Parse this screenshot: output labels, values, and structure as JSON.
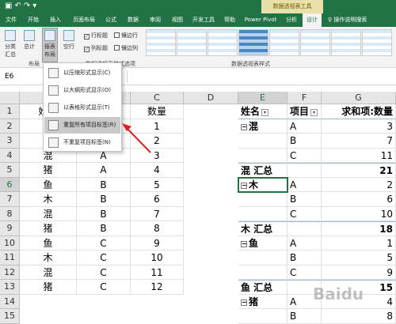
{
  "titlebar": {
    "qat_icons": [
      "save-icon",
      "undo-icon",
      "redo-icon",
      "customize-icon"
    ],
    "context_title": "数据透视表工具"
  },
  "tabs": [
    "文件",
    "开始",
    "插入",
    "页面布局",
    "公式",
    "数据",
    "审阅",
    "视图",
    "开发工具",
    "帮助",
    "Power Pivot",
    "分析",
    "设计"
  ],
  "tell_me": "操作说明搜索",
  "ribbon": {
    "subtotal_label": "分类汇总",
    "grandtotal_label": "总计",
    "report_layout_label": "报表布局",
    "blank_rows_label": "空行",
    "layout_group": "布局",
    "options_group_label": "数据透视表样式选项",
    "styles_group_label": "数据透视表样式",
    "checkboxes": [
      {
        "label": "行标题",
        "checked": true
      },
      {
        "label": "镶边行",
        "checked": false
      },
      {
        "label": "列标题",
        "checked": true
      },
      {
        "label": "镶边列",
        "checked": false
      }
    ]
  },
  "formula_bar": {
    "name_box": "E6",
    "formula": ""
  },
  "dropdown": {
    "items": [
      {
        "label": "以压缩形式显示(C)"
      },
      {
        "label": "以大纲形式显示(O)"
      },
      {
        "label": "以表格形式显示(T)"
      },
      {
        "label": "重复所有项目标签(R)",
        "highlighted": true
      },
      {
        "label": "不重复项目标签(N)"
      }
    ]
  },
  "columns": [
    "A",
    "B",
    "C",
    "D",
    "E",
    "F",
    "G"
  ],
  "rows": [
    "1",
    "2",
    "3",
    "4",
    "5",
    "6",
    "7",
    "8",
    "9",
    "10",
    "11",
    "12",
    "13",
    "14",
    "15"
  ],
  "source_table": {
    "header": [
      "姓名",
      "项目",
      "数量"
    ],
    "rows": [
      [
        "混",
        "A",
        "1"
      ],
      [
        "木",
        "A",
        "2"
      ],
      [
        "混",
        "A",
        "3"
      ],
      [
        "猪",
        "A",
        "4"
      ],
      [
        "鱼",
        "B",
        "5"
      ],
      [
        "木",
        "B",
        "6"
      ],
      [
        "混",
        "B",
        "7"
      ],
      [
        "猪",
        "B",
        "8"
      ],
      [
        "鱼",
        "C",
        "9"
      ],
      [
        "木",
        "C",
        "10"
      ],
      [
        "混",
        "C",
        "11"
      ],
      [
        "猪",
        "C",
        "12"
      ]
    ]
  },
  "pivot": {
    "headers": [
      "姓名",
      "项目",
      "求和项:数量"
    ],
    "rows": [
      {
        "name": "混",
        "item": "A",
        "value": "3",
        "group": true
      },
      {
        "name": "",
        "item": "B",
        "value": "7"
      },
      {
        "name": "",
        "item": "C",
        "value": "11"
      },
      {
        "name": "混 汇总",
        "item": "",
        "value": "21",
        "subtotal": true
      },
      {
        "name": "木",
        "item": "A",
        "value": "2",
        "group": true
      },
      {
        "name": "",
        "item": "B",
        "value": "6"
      },
      {
        "name": "",
        "item": "C",
        "value": "10"
      },
      {
        "name": "木 汇总",
        "item": "",
        "value": "18",
        "subtotal": true
      },
      {
        "name": "鱼",
        "item": "A",
        "value": "1",
        "group": true
      },
      {
        "name": "",
        "item": "B",
        "value": "5"
      },
      {
        "name": "",
        "item": "C",
        "value": "9"
      },
      {
        "name": "鱼 汇总",
        "item": "",
        "value": "15",
        "subtotal": true
      },
      {
        "name": "猪",
        "item": "A",
        "value": "4",
        "group": true
      },
      {
        "name": "",
        "item": "B",
        "value": "8"
      }
    ]
  },
  "watermark": "Baidu"
}
